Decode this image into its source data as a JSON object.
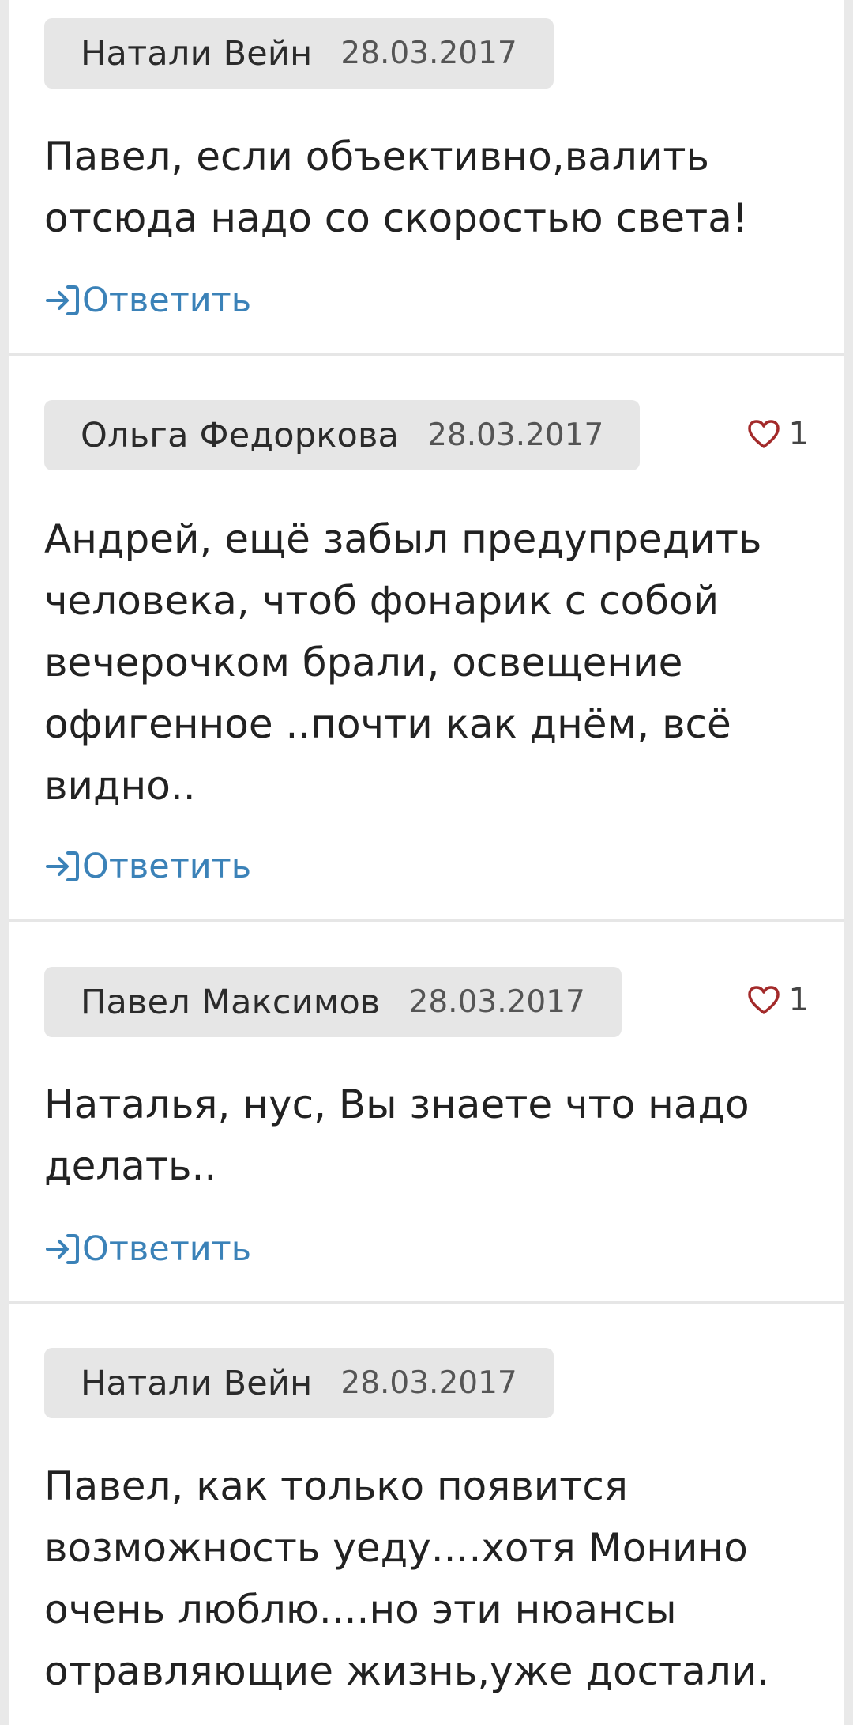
{
  "colors": {
    "background": "#e9e9e9",
    "card": "#ffffff",
    "pill": "#e6e6e6",
    "reply_link": "#3b82b8",
    "heart": "#a32a2a"
  },
  "icons": {
    "reply": "reply-arrow-icon",
    "like": "heart-outline-icon"
  },
  "comments": [
    {
      "author": "Натали Вейн",
      "date": "28.03.2017",
      "text": "Павел, если объективно,валить\nотсюда надо со скоростью света!",
      "reply_label": "Ответить",
      "likes": null
    },
    {
      "author": "Ольга Федоркова",
      "date": "28.03.2017",
      "text": "Андрей, ещё забыл предупредить\nчеловека, чтоб фонарик с собой\nвечерочком брали, освещение\nофигенное ..почти как днём, всё\nвидно..",
      "reply_label": "Ответить",
      "likes": "1"
    },
    {
      "author": "Павел Максимов",
      "date": "28.03.2017",
      "text": "Наталья, нус, Вы знаете что надо\nделать..",
      "reply_label": "Ответить",
      "likes": "1"
    },
    {
      "author": "Натали Вейн",
      "date": "28.03.2017",
      "text": "Павел, как только появится\nвозможность уеду....хотя Монино\nочень люблю....но эти нюансы\nотравляющие жизнь,уже достали.",
      "reply_label": null,
      "likes": null
    }
  ]
}
